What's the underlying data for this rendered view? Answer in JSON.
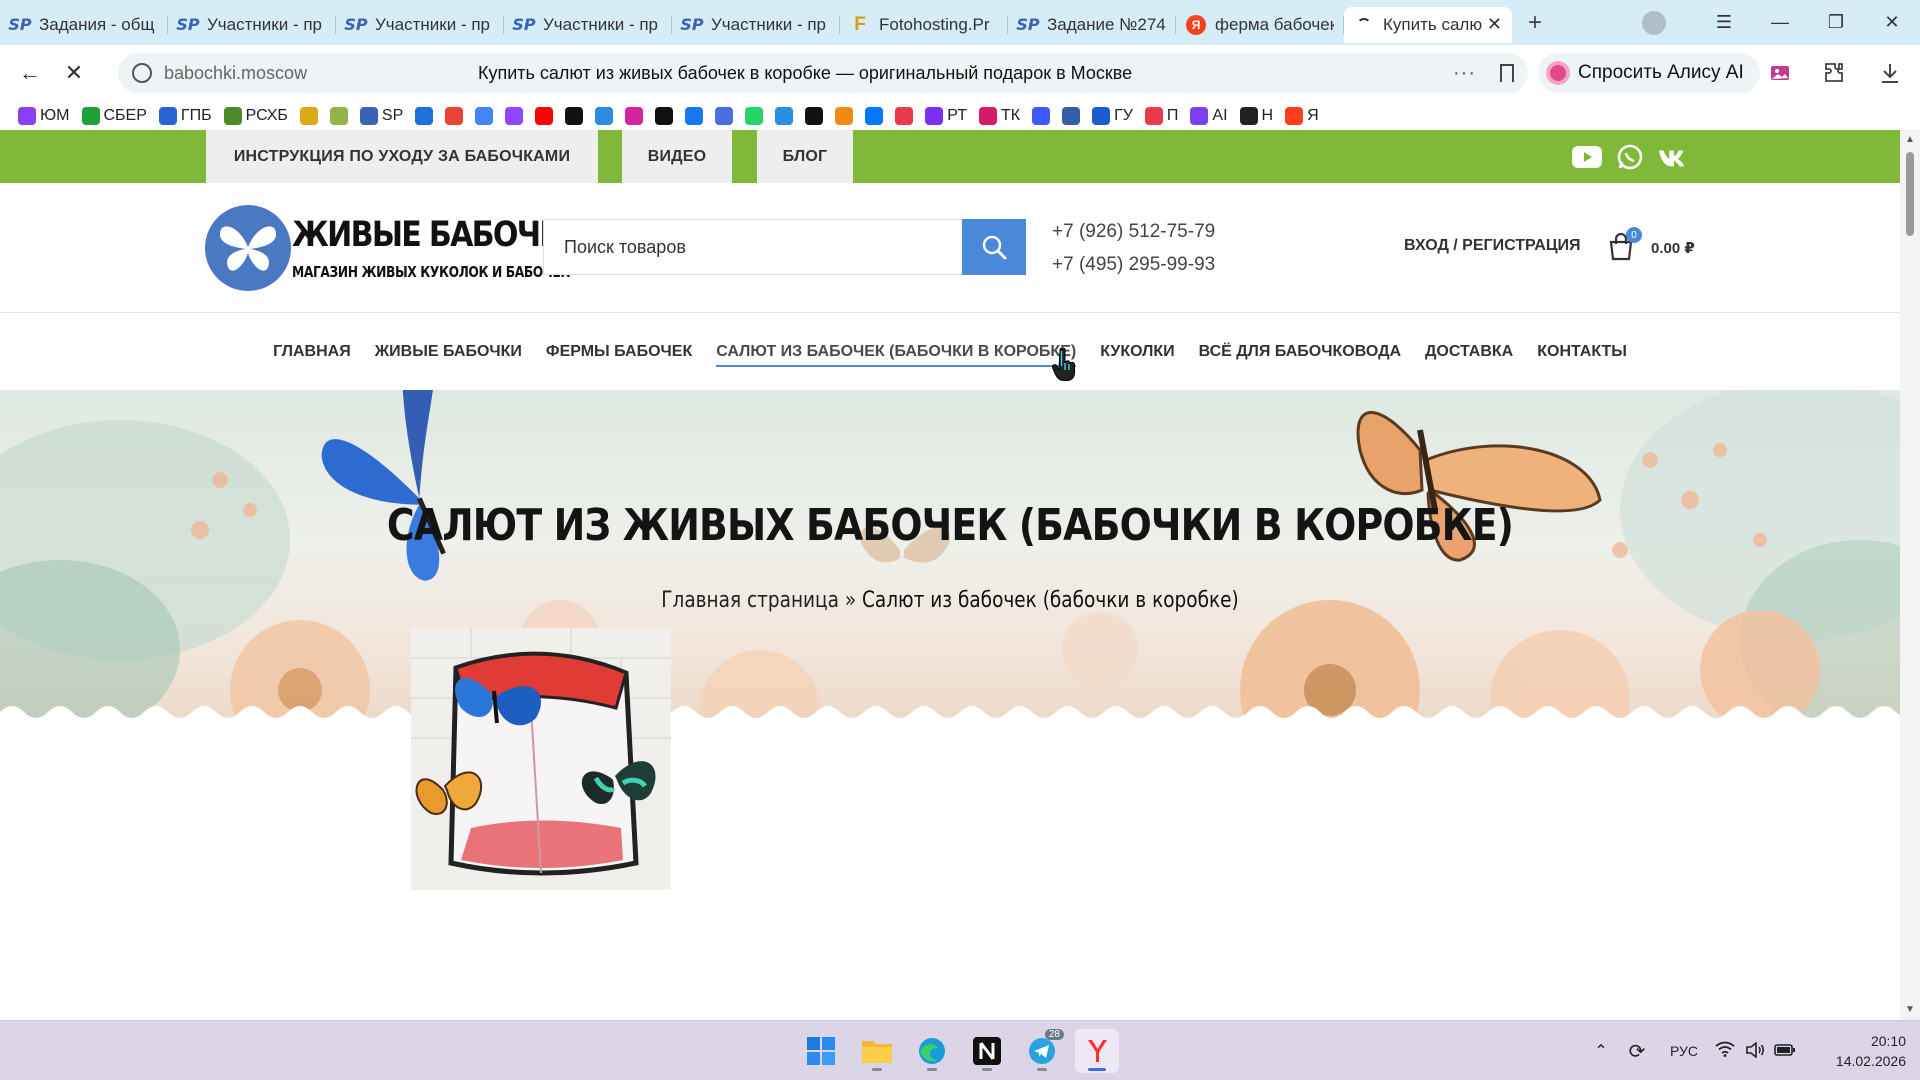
{
  "browser": {
    "tabs": [
      {
        "label": "Задания - общ",
        "icon": "sp-icon"
      },
      {
        "label": "Участники - пр",
        "icon": "sp-icon"
      },
      {
        "label": "Участники - пр",
        "icon": "sp-icon"
      },
      {
        "label": "Участники - пр",
        "icon": "sp-icon"
      },
      {
        "label": "Участники - пр",
        "icon": "sp-icon"
      },
      {
        "label": "Fotohosting.Pr",
        "icon": "fotohosting-icon"
      },
      {
        "label": "Задание №274",
        "icon": "sp-icon"
      },
      {
        "label": "ферма бабочек",
        "icon": "yandex-icon"
      },
      {
        "label": "Купить салю",
        "icon": "loading-icon",
        "active": true
      }
    ],
    "url_domain": "babochki.moscow",
    "page_title": "Купить салют из живых бабочек в коробке — оригинальный подарок в Москве",
    "alice_label": "Спросить Алису AI",
    "bookmarks": [
      {
        "label": "ЮМ",
        "color": "#8b3ff0"
      },
      {
        "label": "СБЕР",
        "color": "#21a038"
      },
      {
        "label": "ГПБ",
        "color": "#2b64d6"
      },
      {
        "label": "РСХБ",
        "color": "#4f8a2b"
      },
      {
        "label": "",
        "color": "#e0a91a"
      },
      {
        "label": "",
        "color": "#8fb54a"
      },
      {
        "label": "SP",
        "color": "#3a63b8"
      },
      {
        "label": "",
        "color": "#1e6fd9"
      },
      {
        "label": "",
        "color": "#ea4335"
      },
      {
        "label": "",
        "color": "#4285f4"
      },
      {
        "label": "",
        "color": "#9146ff"
      },
      {
        "label": "",
        "color": "#ff0000"
      },
      {
        "label": "",
        "color": "#111111"
      },
      {
        "label": "",
        "color": "#2a8fe0"
      },
      {
        "label": "",
        "color": "#d6249f"
      },
      {
        "label": "",
        "color": "#111111"
      },
      {
        "label": "",
        "color": "#1877f2"
      },
      {
        "label": "",
        "color": "#4a6ee0"
      },
      {
        "label": "",
        "color": "#25d366"
      },
      {
        "label": "",
        "color": "#2a8fe0"
      },
      {
        "label": "",
        "color": "#111111"
      },
      {
        "label": "",
        "color": "#f08a14"
      },
      {
        "label": "",
        "color": "#0077ff"
      },
      {
        "label": "",
        "color": "#e8394d"
      },
      {
        "label": "РТ",
        "color": "#7b2ff7"
      },
      {
        "label": "ТК",
        "color": "#d61a6b"
      },
      {
        "label": "",
        "color": "#3d5afe"
      },
      {
        "label": "",
        "color": "#355ea8"
      },
      {
        "label": "ГУ",
        "color": "#1d5bd1"
      },
      {
        "label": "П",
        "color": "#e8394d"
      },
      {
        "label": "AI",
        "color": "#7a3ff0"
      },
      {
        "label": "Н",
        "color": "#222222"
      },
      {
        "label": "Я",
        "color": "#fc3f1d"
      }
    ]
  },
  "site": {
    "topbar_links": [
      "ИНСТРУКЦИЯ ПО УХОДУ ЗА БАБОЧКАМИ",
      "ВИДЕО",
      "БЛОГ"
    ],
    "logo_title": "ЖИВЫЕ БАБОЧКИ",
    "logo_subtitle": "МАГАЗИН ЖИВЫХ КУКОЛОК И БАБОЧЕК",
    "search_placeholder": "Поиск товаров",
    "phone1": "+7 (926) 512-75-79",
    "phone2": "+7 (495) 295-99-93",
    "login": "ВХОД / РЕГИСТРАЦИЯ",
    "cart_count": "0",
    "cart_total": "0.00 ₽",
    "nav": [
      "ГЛАВНАЯ",
      "ЖИВЫЕ БАБОЧКИ",
      "ФЕРМЫ БАБОЧЕК",
      "САЛЮТ ИЗ БАБОЧЕК (БАБОЧКИ В КОРОБКЕ)",
      "КУКОЛКИ",
      "ВСЁ ДЛЯ БАБОЧКОВОДА",
      "ДОСТАВКА",
      "КОНТАКТЫ"
    ],
    "hero_title": "САЛЮТ ИЗ ЖИВЫХ БАБОЧЕК (БАБОЧКИ В КОРОБКЕ)",
    "breadcrumb_home": "Главная страница",
    "breadcrumb_sep": "»",
    "breadcrumb_current": "Салют из бабочек (бабочки в коробке)",
    "colors": {
      "green": "#80b83a",
      "accent": "#4a88d9"
    }
  },
  "taskbar": {
    "telegram_badge": "28",
    "lang": "РУС",
    "time": "20:10",
    "date": "14.02.2026"
  }
}
